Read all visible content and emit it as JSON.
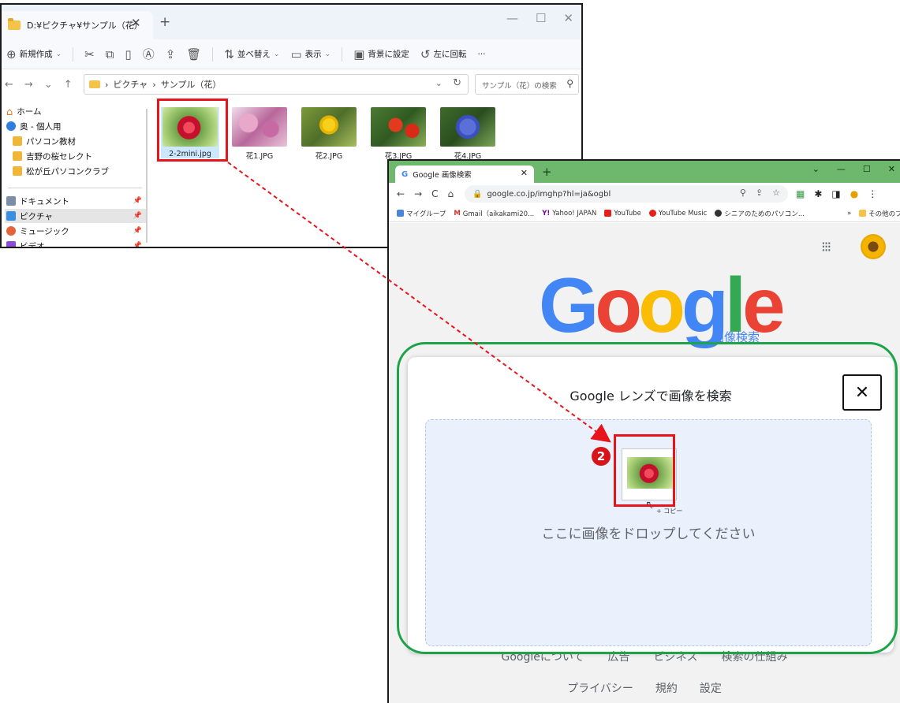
{
  "explorer": {
    "tab_title": "D:¥ピクチャ¥サンプル（花）",
    "toolbar": {
      "new": "新規作成",
      "sort": "並べ替え",
      "view": "表示",
      "set_background": "背景に設定",
      "rotate_left": "左に回転",
      "more": "···"
    },
    "breadcrumb": {
      "part1": "ピクチャ",
      "part2": "サンプル（花）"
    },
    "search_placeholder": "サンプル（花）の検索",
    "nav": {
      "home": "ホーム",
      "personal": "奥 - 個人用",
      "pc_material": "パソコン教材",
      "yoshino": "吉野の桜セレクト",
      "matsugaoka": "松が丘パソコンクラブ",
      "documents": "ドキュメント",
      "pictures": "ピクチャ",
      "music": "ミュージック",
      "videos": "ビデオ"
    },
    "files": [
      {
        "name": "2-2mini.jpg"
      },
      {
        "name": "花1.JPG"
      },
      {
        "name": "花2.JPG"
      },
      {
        "name": "花3.JPG"
      },
      {
        "name": "花4.JPG"
      }
    ]
  },
  "chrome": {
    "tab_title": "Google 画像検索",
    "url": "google.co.jp/imghp?hl=ja&ogbl",
    "bookmarks": {
      "mygroup": "マイグループ",
      "gmail": "Gmail（aikakami20...",
      "yahoo": "Yahoo! JAPAN",
      "youtube": "YouTube",
      "youtube_music": "YouTube Music",
      "senior": "シニアのためのパソコン...",
      "more": "»",
      "other": "その他のブックマーク"
    },
    "logo_subtitle": "画像検索",
    "lens": {
      "title": "Google レンズで画像を検索",
      "drop_text": "ここに画像をドロップしてください",
      "copy_label": "+ コピー"
    },
    "footer": {
      "about": "Googleについて",
      "ads": "広告",
      "business": "ビジネス",
      "how_search": "検索の仕組み",
      "privacy": "プライバシー",
      "terms": "規約",
      "settings": "設定"
    }
  },
  "annotation": {
    "step_number": "2"
  }
}
